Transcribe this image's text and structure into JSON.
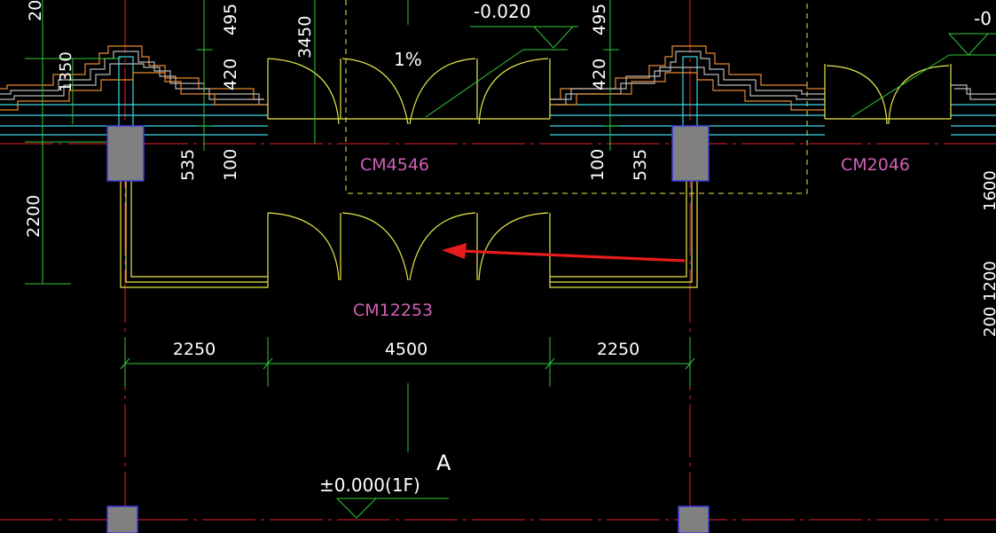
{
  "drawing": {
    "background": "#000000",
    "colors": {
      "axis": "#e8202a",
      "dimension": "#2ec83a",
      "wall": "#3cd8e8",
      "door": "#e8e84a",
      "stair": "#e88a30",
      "column_fill": "#808080",
      "column_edge": "#3a3ad8",
      "tag": "#d060b8",
      "outline": "#e8e84a",
      "arrow": "#e81c1c",
      "text": "#ffffff"
    },
    "dimensions": {
      "top_495_left": "495",
      "top_495_right": "495",
      "top_420_left": "420",
      "top_420_right": "420",
      "d_1350": "1350",
      "d_3450": "3450",
      "d_535_left": "535",
      "d_535_right": "535",
      "d_100_left": "100",
      "d_100_right": "100",
      "d_2200": "2200",
      "d_20_partial": "20",
      "bottom_2250_left": "2250",
      "bottom_4500": "4500",
      "bottom_2250_right": "2250",
      "right_edge_partial_1": "1600",
      "right_edge_partial_2": "200 1200"
    },
    "levels": {
      "top_level": "-0.020",
      "top_level_right_partial": "-0",
      "ground_level": "±0.000(1F)"
    },
    "slope": "1%",
    "door_tags": {
      "upper_middle": "CM4546",
      "upper_right": "CM2046",
      "lower_main": "CM12253"
    },
    "grid_axis_label": "A"
  }
}
